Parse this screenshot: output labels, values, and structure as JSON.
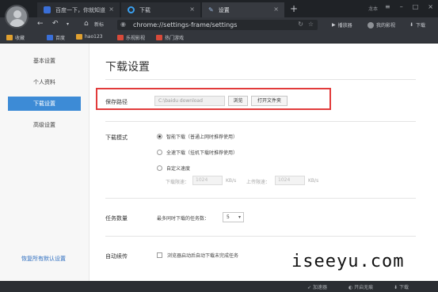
{
  "tabs": [
    {
      "title": "百度一下，你就知道",
      "icon": "baidu-icon"
    },
    {
      "title": "下载",
      "icon": "download-icon"
    },
    {
      "title": "设置",
      "icon": "wrench-icon"
    }
  ],
  "window": {
    "user_label": "龙本"
  },
  "nav": {
    "home_label": "新标",
    "url": "chrome://settings-frame/settings",
    "right_buttons": [
      "播放器",
      "我的影视",
      "下载"
    ]
  },
  "bookmarks": [
    {
      "label": "收藏",
      "color": "#e0a030"
    },
    {
      "label": "百度",
      "color": "#3a6fd8"
    },
    {
      "label": "hao123",
      "color": "#e0a030"
    },
    {
      "label": "乐视影视",
      "color": "#d84a3a"
    },
    {
      "label": "热门游戏",
      "color": "#d84a3a"
    }
  ],
  "sidebar": {
    "items": [
      {
        "label": "基本设置",
        "active": false
      },
      {
        "label": "个人资料",
        "active": false
      },
      {
        "label": "下载设置",
        "active": true
      },
      {
        "label": "高级设置",
        "active": false
      }
    ],
    "restore_label": "恢复所有默认设置"
  },
  "main": {
    "title": "下载设置",
    "save_path": {
      "label": "保存路径",
      "value": "C:\\baidu download",
      "browse_label": "浏览",
      "open_folder_label": "打开文件夹"
    },
    "download_mode": {
      "label": "下载模式",
      "options": [
        {
          "label": "智能下载（普通上网时推荐使用）",
          "selected": true
        },
        {
          "label": "全速下载（挂机下载时推荐使用）",
          "selected": false
        },
        {
          "label": "自定义速度",
          "selected": false
        }
      ],
      "download_speed_label": "下载限速：",
      "download_speed_value": "1024",
      "upload_speed_label": "上传限速：",
      "upload_speed_value": "1024",
      "unit": "KB/s"
    },
    "task_count": {
      "label": "任务数量",
      "desc": "最多同时下载的任务数：",
      "value": "5"
    },
    "auto_resume": {
      "label": "自动续传",
      "checkbox_label": "浏览器启动后自动下载未完成任务",
      "checked": false
    }
  },
  "statusbar": {
    "items": [
      "加速器",
      "开启无痕",
      "下载"
    ]
  },
  "watermark": "iseeyu.com",
  "colors": {
    "accent": "#3d8bd6",
    "highlight_border": "#e23b3b",
    "chrome_dark": "#1f2226"
  }
}
